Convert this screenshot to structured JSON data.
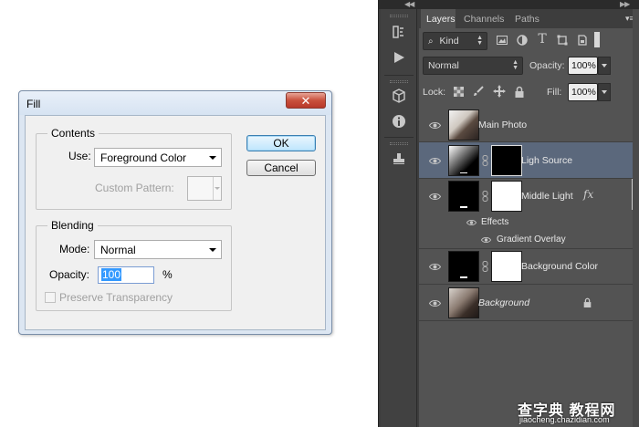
{
  "fill_dialog": {
    "title": "Fill",
    "close_glyph": "✕",
    "contents": {
      "group_label": "Contents",
      "use_label": "Use:",
      "use_value": "Foreground Color",
      "custom_pattern_label": "Custom Pattern:"
    },
    "blending": {
      "group_label": "Blending",
      "mode_label": "Mode:",
      "mode_value": "Normal",
      "opacity_label": "Opacity:",
      "opacity_value": "100",
      "opacity_unit": "%",
      "preserve_label": "Preserve Transparency",
      "preserve_checked": false
    },
    "buttons": {
      "ok": "OK",
      "cancel": "Cancel"
    }
  },
  "photoshop": {
    "tabs": [
      {
        "label": "Layers",
        "active": true
      },
      {
        "label": "Channels",
        "active": false
      },
      {
        "label": "Paths",
        "active": false
      }
    ],
    "filter": {
      "kind_label": "Kind"
    },
    "blend_mode": "Normal",
    "opacity": {
      "label": "Opacity:",
      "value": "100%"
    },
    "lock": {
      "label": "Lock:"
    },
    "fill": {
      "label": "Fill:",
      "value": "100%"
    },
    "layers": [
      {
        "name": "Main Photo",
        "selected": false,
        "italic": false
      },
      {
        "name": "Ligh Source",
        "selected": true,
        "italic": false
      },
      {
        "name": "Middle Light",
        "selected": false,
        "italic": false,
        "fx": "fx"
      },
      {
        "name": "Effects",
        "kind": "effects-header"
      },
      {
        "name": "Gradient Overlay",
        "kind": "effect"
      },
      {
        "name": "Background Color",
        "selected": false,
        "italic": false
      },
      {
        "name": "Background",
        "selected": false,
        "italic": true
      }
    ],
    "colors": {
      "panel": "#535353",
      "selected_layer": "#5b687c",
      "dark": "#3d3d3d"
    }
  },
  "watermark": {
    "main": "查字典 教程网",
    "sub": "jiaocheng.chazidian.com"
  }
}
